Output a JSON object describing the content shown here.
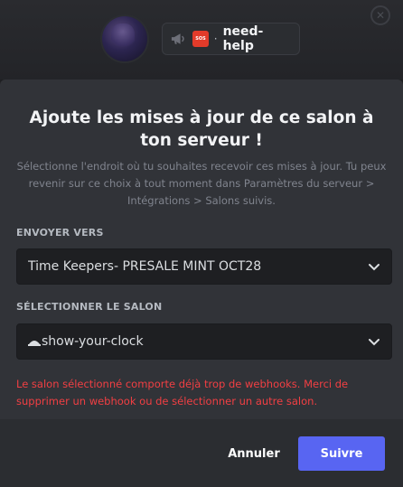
{
  "header": {
    "channel_name": "need-help",
    "channel_separator": "·",
    "server_badge_text": "SOS"
  },
  "modal": {
    "title": "Ajoute les mises à jour de ce salon à ton serveur !",
    "description": "Sélectionne l'endroit où tu souhaites recevoir ces mises à jour. Tu peux revenir sur ce choix à tout moment dans Paramètres du serveur > Intégrations > Salons suivis.",
    "send_to_label": "ENVOYER VERS",
    "server_select_value": "Time Keepers- PRESALE MINT OCT28",
    "channel_label": "SÉLECTIONNER LE SALON",
    "channel_select_value": "show-your-clock",
    "error_message": "Le salon sélectionné comporte déjà trop de webhooks. Merci de supprimer un webhook ou de sélectionner un autre salon."
  },
  "footer": {
    "cancel_label": "Annuler",
    "next_label": "Suivre"
  },
  "icons": {
    "announcement": "megaphone-icon",
    "chevron": "chevron-down-icon",
    "channel_type": "rules-icon"
  },
  "colors": {
    "accent": "#5865f2",
    "error": "#f23f43",
    "modal_bg": "#313338",
    "footer_bg": "#2b2d31",
    "input_bg": "#1e1f22"
  }
}
